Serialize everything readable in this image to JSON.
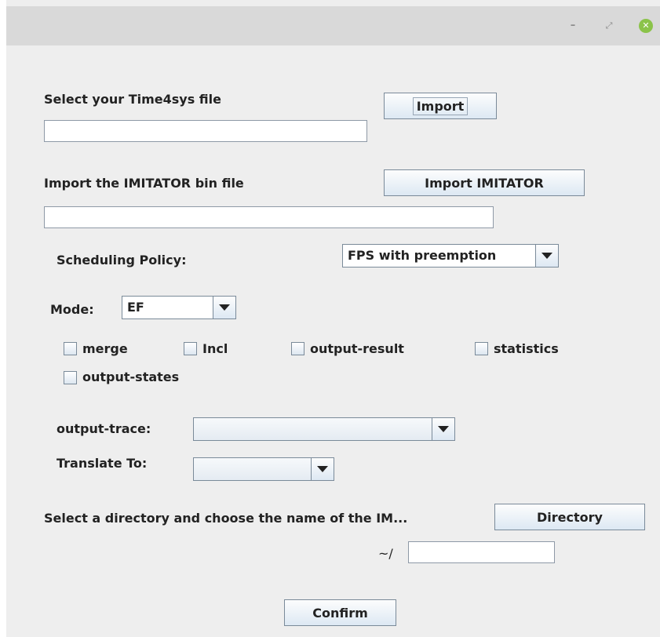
{
  "window": {
    "controls": {
      "minimize": "–",
      "maximize": "⤢",
      "close": "✕"
    }
  },
  "time4sys": {
    "label": "Select your Time4sys file",
    "import_button": "Import",
    "path_value": ""
  },
  "imitator": {
    "label": "Import the IMITATOR bin file",
    "import_button": "Import IMITATOR",
    "path_value": ""
  },
  "scheduling": {
    "label": "Scheduling Policy:",
    "selected": "FPS with preemption"
  },
  "mode": {
    "label": "Mode:",
    "selected": "EF"
  },
  "options": {
    "merge": "merge",
    "incl": "Incl",
    "output_result": "output-result",
    "statistics": "statistics",
    "output_states": "output-states"
  },
  "output_trace": {
    "label": "output-trace:",
    "selected": ""
  },
  "translate": {
    "label": "Translate To:",
    "selected": ""
  },
  "directory": {
    "label": "Select a directory and choose the name of the IM...",
    "button": "Directory",
    "prefix": "~/",
    "name_value": ""
  },
  "confirm_button": "Confirm",
  "colors": {
    "window_bg": "#eeeeee",
    "titlebar_bg": "#d9d9d9",
    "close_button": "#8bc34a",
    "border": "#7a8a99"
  }
}
